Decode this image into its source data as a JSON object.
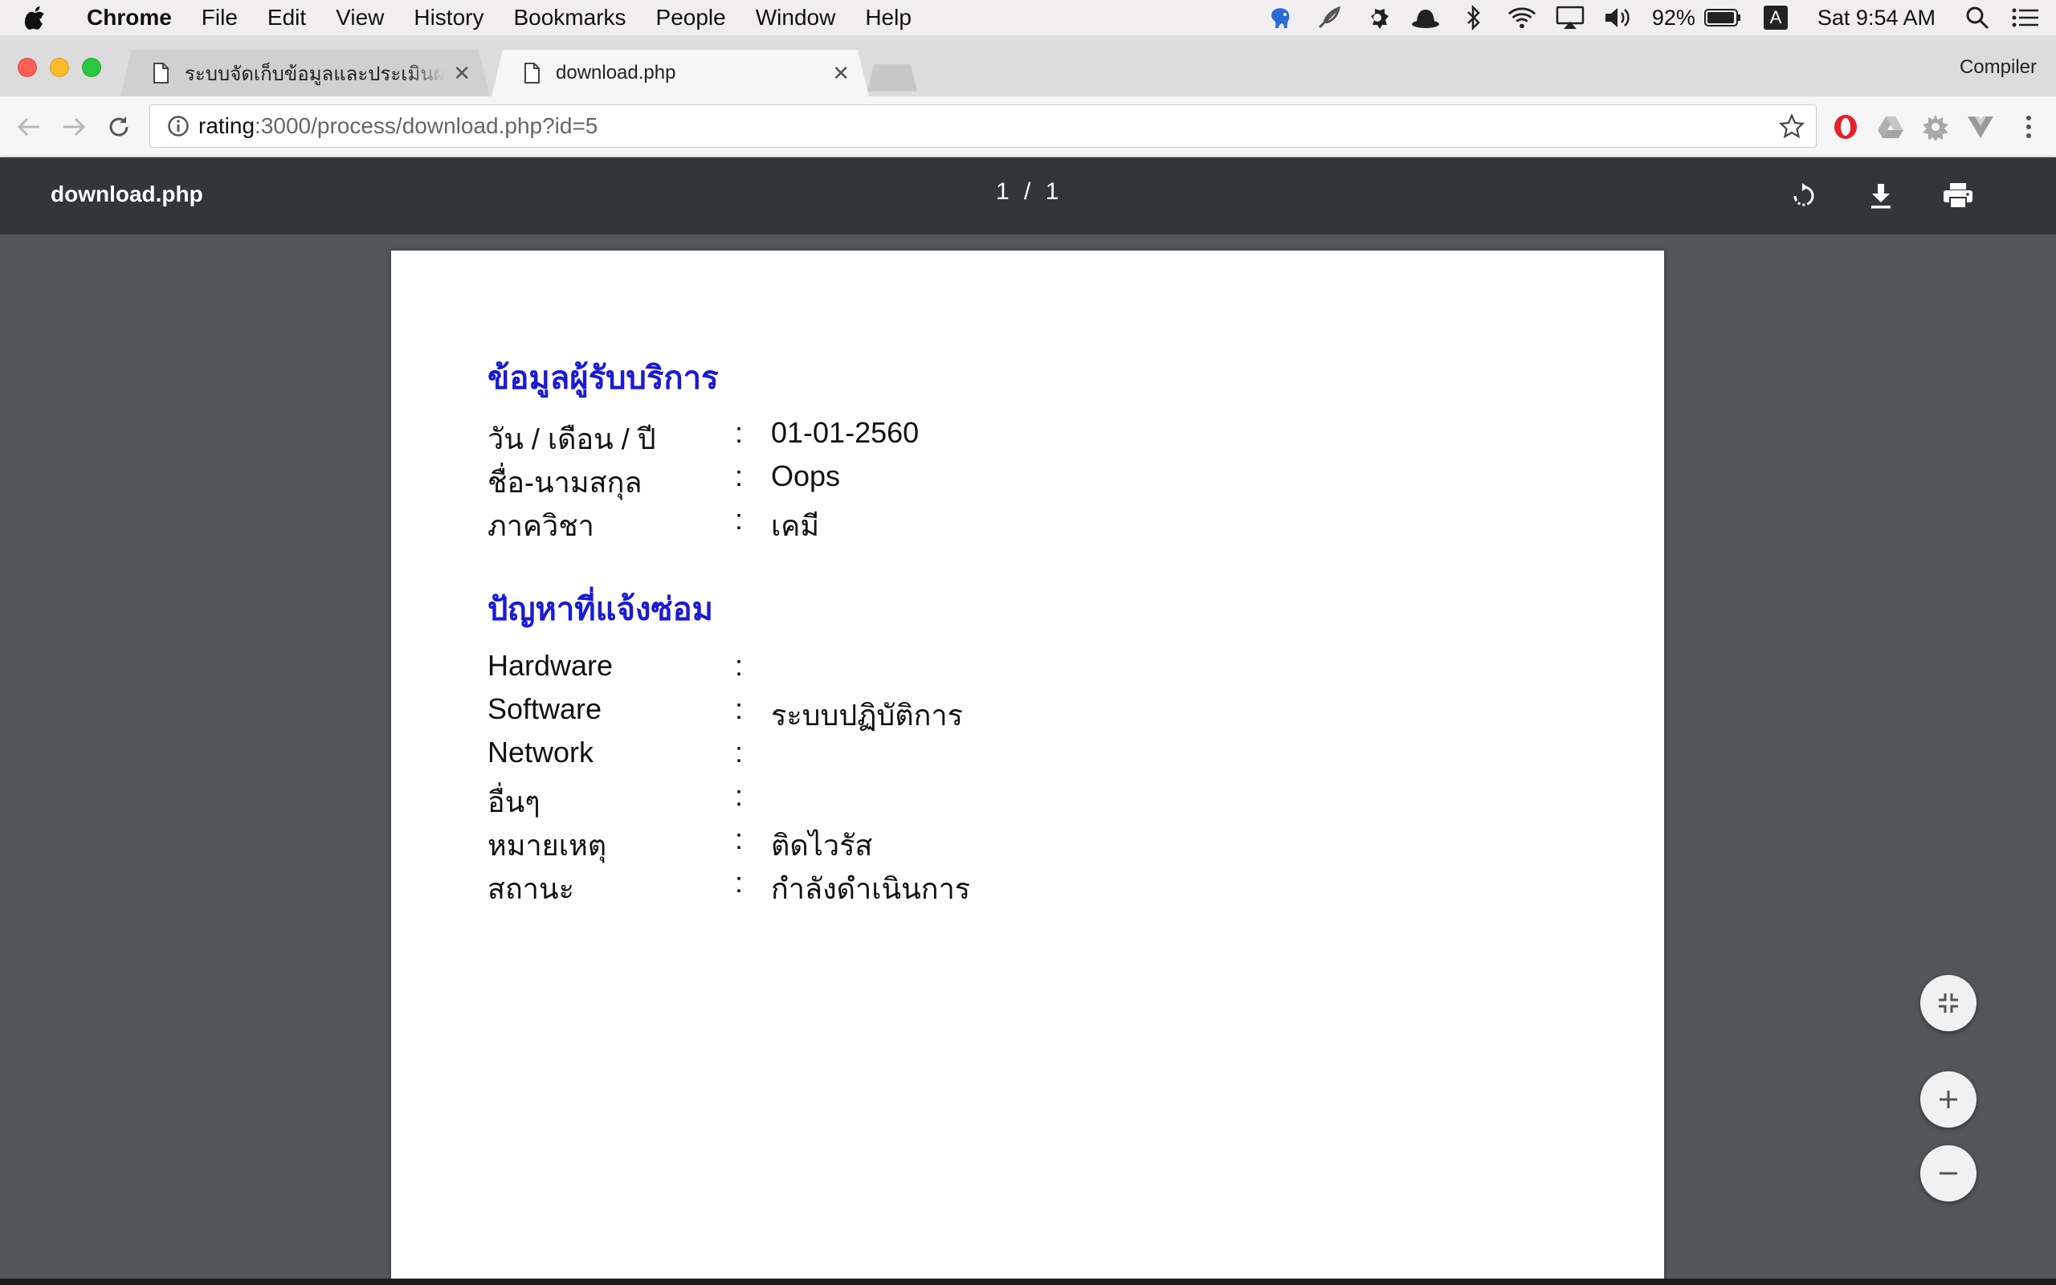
{
  "menubar": {
    "app_name": "Chrome",
    "items": [
      "File",
      "Edit",
      "View",
      "History",
      "Bookmarks",
      "People",
      "Window",
      "Help"
    ],
    "battery": "92%",
    "clock": "Sat 9:54 AM",
    "status_icons": [
      "evernote-icon",
      "feather-icon",
      "settings-icon",
      "bowler-hat-icon",
      "bluetooth-icon",
      "wifi-icon",
      "airplay-icon",
      "volume-icon",
      "battery-icon",
      "input-source-icon",
      "spotlight-icon",
      "notification-center-icon"
    ],
    "input_source": "A"
  },
  "tabs": [
    {
      "title": "ระบบจัดเก็บข้อมูลและประเมินผลความ",
      "active": false
    },
    {
      "title": "download.php",
      "active": true
    }
  ],
  "profile_name": "Compiler",
  "omnibox": {
    "host": "rating",
    "path": ":3000/process/download.php?id=5"
  },
  "extensions": [
    "opera-icon",
    "drive-icon",
    "gear-extension-icon",
    "vue-devtools-icon",
    "chrome-menu-icon"
  ],
  "pdf": {
    "filename": "download.php",
    "page_current": "1",
    "page_separator": "/",
    "page_total": "1"
  },
  "document": {
    "section1_title": "ข้อมูลผู้รับบริการ",
    "section1_rows": [
      {
        "label": "วัน / เดือน / ปี",
        "value": "01-01-2560"
      },
      {
        "label": "ชื่อ-นามสกุล",
        "value": "Oops"
      },
      {
        "label": "ภาควิชา",
        "value": "เคมี"
      }
    ],
    "section2_title": "ปัญหาที่แจ้งซ่อม",
    "section2_rows": [
      {
        "label": "Hardware",
        "value": ""
      },
      {
        "label": "Software",
        "value": "ระบบปฏิบัติการ"
      },
      {
        "label": "Network",
        "value": ""
      },
      {
        "label": "อื่นๆ",
        "value": ""
      },
      {
        "label": "หมายเหตุ",
        "value": "ติดไวรัส"
      },
      {
        "label": "สถานะ",
        "value": "กำลังดำเนินการ"
      }
    ],
    "separator": ":"
  },
  "colors": {
    "section_title": "#1a1ad6",
    "pdf_toolbar": "#323639",
    "viewer_bg": "#525659"
  }
}
